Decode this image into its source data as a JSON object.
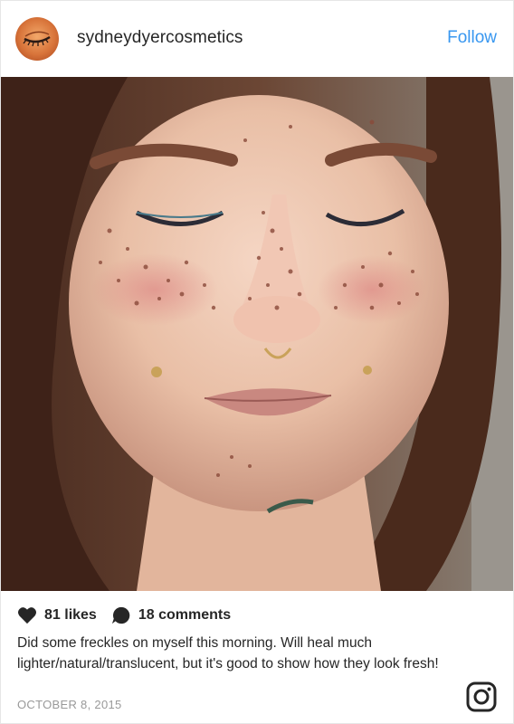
{
  "header": {
    "username": "sydneydyercosmetics",
    "follow_label": "Follow",
    "follow_color": "#3897f0"
  },
  "post": {
    "photo_description_icon": "photo",
    "likes": "81 likes",
    "comments": "18 comments",
    "caption": "Did some freckles on myself this morning. Will heal much lighter/natural/translucent, but it's good to show how they look fresh!",
    "date": "OCTOBER 8, 2015"
  },
  "icons": {
    "like": "heart-icon",
    "comment": "comment-bubble-icon",
    "brand": "instagram-icon"
  }
}
